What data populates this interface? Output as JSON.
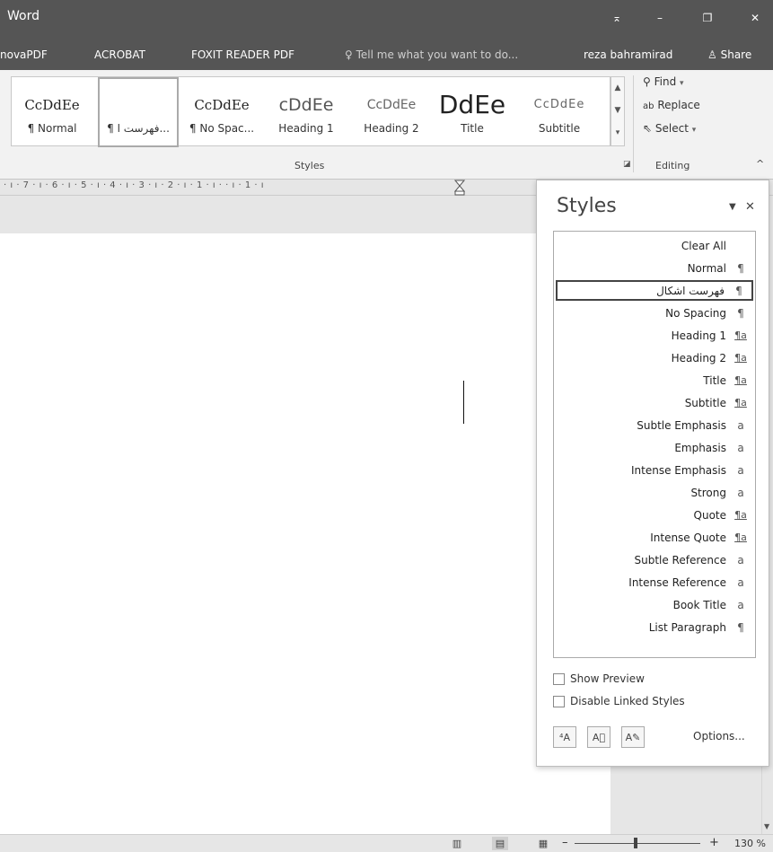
{
  "titlebar": {
    "app": "Word",
    "buttons": {
      "ribbon_display": "⌅",
      "minimize": "–",
      "restore": "❐",
      "close": "✕"
    }
  },
  "menubar": {
    "items": [
      "novaPDF",
      "ACROBAT",
      "FOXIT READER PDF"
    ],
    "tell_me": "Tell me what you want to do...",
    "user": "reza bahramirad",
    "share": "Share"
  },
  "ribbon": {
    "styles_group_label": "Styles",
    "editing_group_label": "Editing",
    "gallery": [
      {
        "preview": "CcDdEe",
        "label": "¶ Normal"
      },
      {
        "preview": "",
        "label": "¶ فهرست ا..."
      },
      {
        "preview": "CcDdEe",
        "label": "¶ No Spac..."
      },
      {
        "preview": "cDdEe",
        "label": "Heading 1"
      },
      {
        "preview": "CcDdEe",
        "label": "Heading 2"
      },
      {
        "preview": "DdEe",
        "label": "Title"
      },
      {
        "preview": "CcDdEe",
        "label": "Subtitle"
      }
    ],
    "editing": {
      "find": "Find",
      "replace": "Replace",
      "select": "Select"
    }
  },
  "ruler": {
    "marks": "· ı · 7 · ı · 6 · ı · 5 · ı · 4 · ı · 3 · ı · 2 · ı · 1 · ı ·     · ı · 1 · ı"
  },
  "styles_pane": {
    "title": "Styles",
    "rows": [
      {
        "name": "Clear All",
        "glyph": ""
      },
      {
        "name": "Normal",
        "glyph": "¶"
      },
      {
        "name": "فهرست اشکال",
        "glyph": "¶"
      },
      {
        "name": "No Spacing",
        "glyph": "¶"
      },
      {
        "name": "Heading 1",
        "glyph": "¶a"
      },
      {
        "name": "Heading 2",
        "glyph": "¶a"
      },
      {
        "name": "Title",
        "glyph": "¶a"
      },
      {
        "name": "Subtitle",
        "glyph": "¶a"
      },
      {
        "name": "Subtle Emphasis",
        "glyph": "a"
      },
      {
        "name": "Emphasis",
        "glyph": "a"
      },
      {
        "name": "Intense Emphasis",
        "glyph": "a"
      },
      {
        "name": "Strong",
        "glyph": "a"
      },
      {
        "name": "Quote",
        "glyph": "¶a"
      },
      {
        "name": "Intense Quote",
        "glyph": "¶a"
      },
      {
        "name": "Subtle Reference",
        "glyph": "a"
      },
      {
        "name": "Intense Reference",
        "glyph": "a"
      },
      {
        "name": "Book Title",
        "glyph": "a"
      },
      {
        "name": "List Paragraph",
        "glyph": "¶"
      }
    ],
    "show_preview": "Show Preview",
    "disable_linked": "Disable Linked Styles",
    "options": "Options..."
  },
  "status": {
    "zoom": "130 %"
  }
}
